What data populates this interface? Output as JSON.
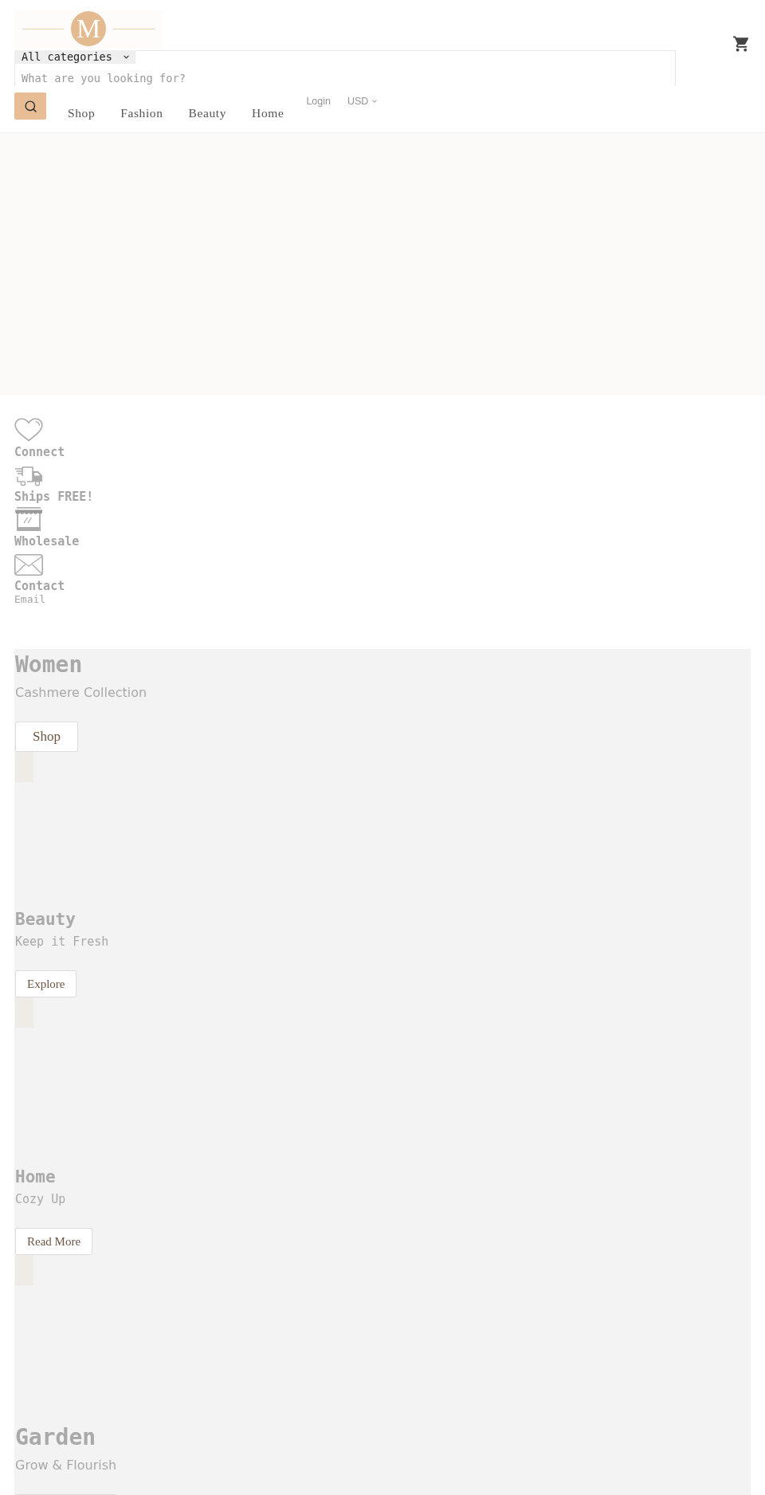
{
  "header": {
    "logo": {
      "letter": "M"
    },
    "search": {
      "category": "All categories",
      "placeholder": "What are you looking for?"
    },
    "nav": [
      "Shop",
      "Fashion",
      "Beauty",
      "Home"
    ],
    "account": {
      "login": "Login",
      "currency": "USD"
    }
  },
  "features": [
    {
      "label": "Connect"
    },
    {
      "label": "Ships FREE!"
    },
    {
      "label": "Wholesale"
    },
    {
      "label": "Contact",
      "detail": "Email"
    }
  ],
  "collections": [
    {
      "kind": "large",
      "title": "Women",
      "subtitle": "Cashmere Collection",
      "button": "Shop"
    },
    {
      "kind": "compact",
      "title": "Beauty",
      "subtitle": "Keep it Fresh",
      "button": "Explore"
    },
    {
      "kind": "compact",
      "title": "Home",
      "subtitle": "Cozy Up",
      "button": "Read More"
    },
    {
      "kind": "large",
      "title": "Garden",
      "subtitle": "Grow & Flourish",
      "partial_button": true
    }
  ]
}
